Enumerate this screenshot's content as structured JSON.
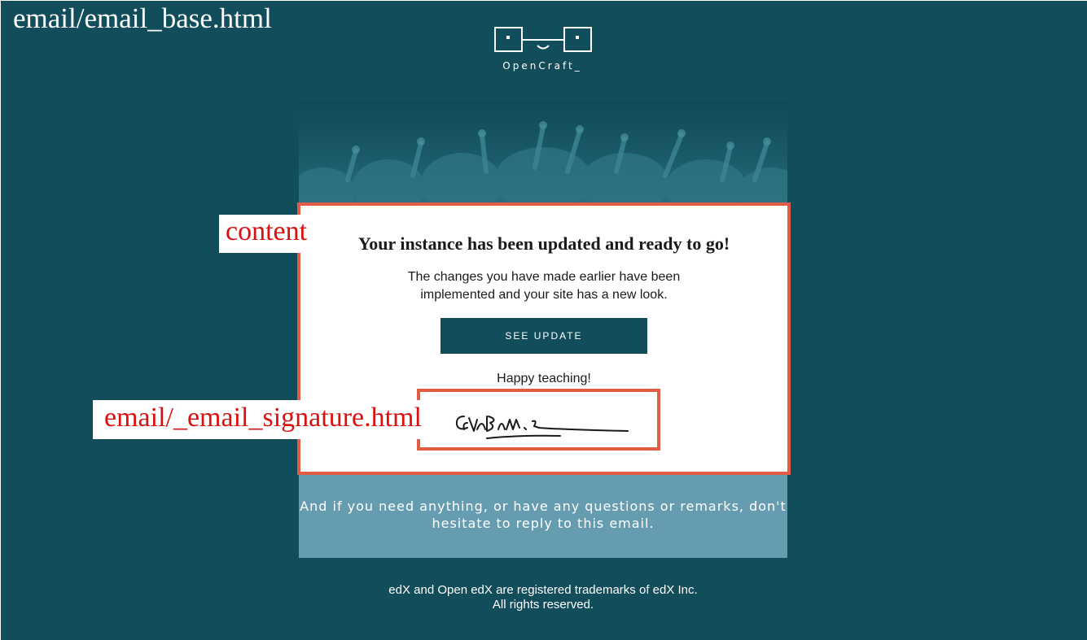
{
  "annotations": {
    "base_template": "email/email_base.html",
    "content_block": "content",
    "signature_template": "email/_email_signature.html"
  },
  "logo": {
    "name": "OpenCraft_",
    "icon": "opencraft-glasses-logo"
  },
  "hero": {
    "icon": "crowd-photo-banner"
  },
  "email": {
    "headline": "Your instance has been updated and ready to go!",
    "body": "The changes you have made earlier have been implemented and your site has a new look.",
    "cta_label": "SEE UPDATE",
    "closing": "Happy teaching!",
    "signature_icon": "handwritten-signature"
  },
  "footer": {
    "help_text": "And if you need anything, or have any questions or remarks, don't hesitate to reply to this email.",
    "legal_line1": "edX and Open edX are registered trademarks of edX Inc.",
    "legal_line2": "All rights reserved."
  },
  "colors": {
    "background": "#124d5b",
    "highlight": "#e35c48",
    "label_text": "#d8100f",
    "footer_panel": "#669caf"
  }
}
